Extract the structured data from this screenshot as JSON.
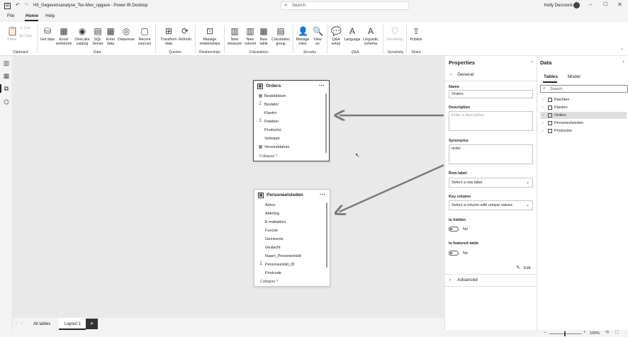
{
  "window": {
    "title": "H5_Gegevensanalyse_Tex-Mex_opgave - Power BI Desktop",
    "search_placeholder": "Search",
    "user": "Kelly Decroock"
  },
  "menu": [
    "File",
    "Home",
    "Help"
  ],
  "ribbon": {
    "buttons": [
      {
        "label": "Paste",
        "icon": "paste-icon"
      },
      {
        "label": "Cut",
        "icon": "cut-icon"
      },
      {
        "label": "Copy",
        "icon": "copy-icon"
      },
      {
        "label": "Get data",
        "icon": "get-data-icon"
      },
      {
        "label": "Excel workbook",
        "icon": "excel-icon"
      },
      {
        "label": "OneLake catalog",
        "icon": "onelake-icon"
      },
      {
        "label": "SQL Server",
        "icon": "sql-server-icon"
      },
      {
        "label": "Enter data",
        "icon": "enter-data-icon"
      },
      {
        "label": "Dataverse",
        "icon": "dataverse-icon"
      },
      {
        "label": "Recent sources",
        "icon": "recent-sources-icon"
      },
      {
        "label": "Transform data",
        "icon": "transform-data-icon"
      },
      {
        "label": "Refresh",
        "icon": "refresh-icon"
      },
      {
        "label": "Manage relationships",
        "icon": "relationships-icon"
      },
      {
        "label": "New measure",
        "icon": "new-measure-icon"
      },
      {
        "label": "New column",
        "icon": "new-column-icon"
      },
      {
        "label": "New table",
        "icon": "new-table-icon"
      },
      {
        "label": "Calculation group",
        "icon": "calculation-group-icon"
      },
      {
        "label": "Manage roles",
        "icon": "manage-roles-icon"
      },
      {
        "label": "View as",
        "icon": "view-as-icon"
      },
      {
        "label": "Q&A setup",
        "icon": "qa-setup-icon"
      },
      {
        "label": "Language",
        "icon": "language-icon"
      },
      {
        "label": "Linguistic schema",
        "icon": "linguistic-schema-icon"
      },
      {
        "label": "Sensitivity",
        "icon": "sensitivity-icon"
      },
      {
        "label": "Publish",
        "icon": "publish-icon"
      }
    ],
    "groups": [
      "Clipboard",
      "Data",
      "Queries",
      "Relationships",
      "Calculations",
      "Security",
      "Q&A",
      "Sensitivity",
      "Share"
    ]
  },
  "canvas": {
    "orders": {
      "name": "Orders",
      "fields": [
        {
          "name": "Besteldatum",
          "icon": "calendar-icon"
        },
        {
          "name": "Bestelnr",
          "icon": "sigma-icon"
        },
        {
          "name": "Klantnr",
          "icon": ""
        },
        {
          "name": "Paletten",
          "icon": "sigma-icon"
        },
        {
          "name": "Productnr",
          "icon": ""
        },
        {
          "name": "Verkoper",
          "icon": ""
        },
        {
          "name": "Verzenddatum",
          "icon": "calendar-icon"
        }
      ],
      "collapse": "Collapse ^"
    },
    "personeel": {
      "name": "Personeelsleden",
      "fields": [
        {
          "name": "Adres",
          "icon": ""
        },
        {
          "name": "Afdeling",
          "icon": ""
        },
        {
          "name": "E-mailadres",
          "icon": ""
        },
        {
          "name": "Functie",
          "icon": ""
        },
        {
          "name": "Gemeente",
          "icon": ""
        },
        {
          "name": "Geslacht",
          "icon": ""
        },
        {
          "name": "Naam_Personeelslid",
          "icon": ""
        },
        {
          "name": "Personeelslid_ID",
          "icon": "sigma-icon"
        },
        {
          "name": "Postcode",
          "icon": ""
        }
      ],
      "collapse": "Collapse ^"
    }
  },
  "tabs": {
    "all_tables": "All tables",
    "layout": "Layout 1",
    "add": "+"
  },
  "status": {
    "zoom": "100%"
  },
  "properties": {
    "title": "Properties",
    "general": "General",
    "name_label": "Name",
    "name_value": "Orders",
    "description_label": "Description",
    "description_placeholder": "Enter a description",
    "synonyms_label": "Synonyms",
    "synonyms_value": "order",
    "row_label": "Row label",
    "row_label_value": "Select a row label",
    "key_column_label": "Key column",
    "key_column_value": "Select a column with unique values",
    "is_hidden_label": "Is hidden",
    "is_hidden_value": "No",
    "is_featured_label": "Is featured table",
    "is_featured_value": "No",
    "edit": "Edit",
    "advanced": "Advanced"
  },
  "datapane": {
    "title": "Data",
    "tab_tables": "Tables",
    "tab_model": "Model",
    "search_placeholder": "Search",
    "items": [
      "Klachten",
      "Klanten",
      "Orders",
      "Personeelsleden",
      "Producten"
    ],
    "selected": "Orders"
  }
}
